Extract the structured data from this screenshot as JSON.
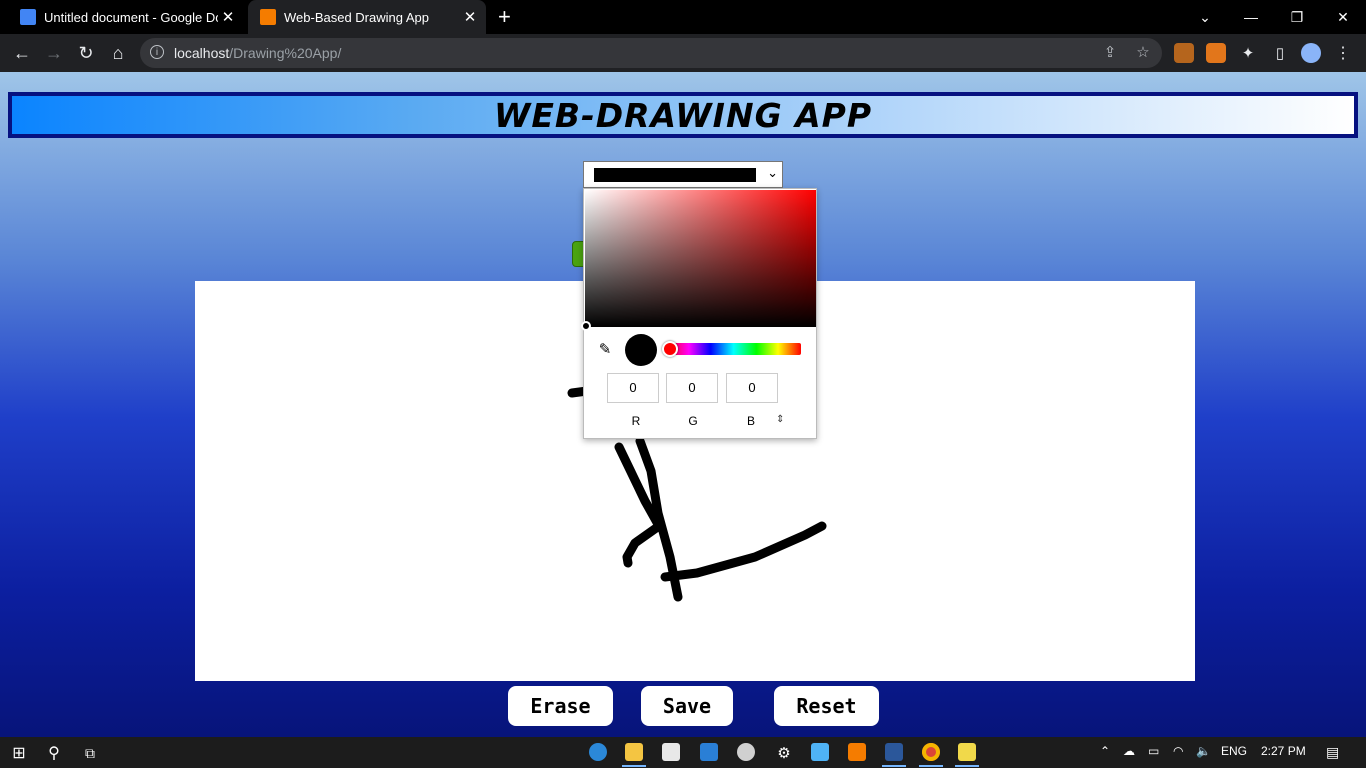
{
  "browser": {
    "tabs": [
      {
        "title": "Untitled document - Google Doc",
        "favicon_color": "#4285f4",
        "active": false
      },
      {
        "title": "Web-Based Drawing App",
        "favicon_color": "#f57c00",
        "active": true
      }
    ],
    "new_tab_glyph": "+",
    "address": {
      "host": "localhost",
      "path": "/Drawing%20App/"
    },
    "icons": {
      "back": "←",
      "forward": "→",
      "reload": "↻",
      "home": "⌂",
      "info": "i",
      "share": "⇪",
      "star": "☆",
      "puzzle": "✦",
      "sidepanel": "▯",
      "chevron": "⌄",
      "minimize": "—",
      "restore": "❐",
      "close": "✕"
    }
  },
  "app": {
    "title": "WEB-DRAWING APP",
    "buttons": {
      "erase": "Erase",
      "save": "Save",
      "reset": "Reset"
    },
    "selected_color": "#000000"
  },
  "color_picker": {
    "r": "0",
    "g": "0",
    "b": "0",
    "labels": {
      "r": "R",
      "g": "G",
      "b": "B"
    },
    "hue_color": "#ff0000",
    "swap_glyph": "⇕"
  },
  "taskbar": {
    "language": "ENG",
    "time": "2:27 PM"
  }
}
